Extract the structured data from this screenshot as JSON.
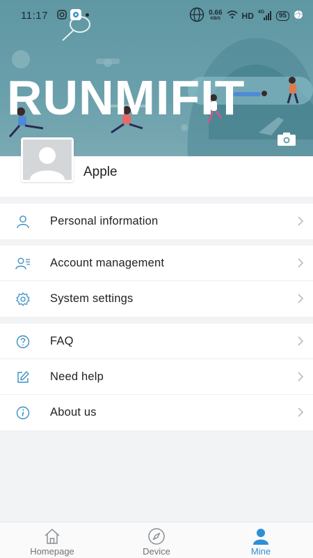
{
  "status_bar": {
    "time": "11:17",
    "network_speed_value": "0.66",
    "network_speed_unit": "KB/S",
    "hd_label": "HD",
    "signal_label": "4G",
    "battery": "95"
  },
  "header": {
    "brand": "RUNMIFIT",
    "camera_icon": "camera-icon"
  },
  "profile": {
    "username": "Apple",
    "avatar_icon": "default-avatar"
  },
  "menu": {
    "group1": [
      {
        "label": "Personal information",
        "icon": "person-icon"
      }
    ],
    "group2": [
      {
        "label": "Account management",
        "icon": "account-list-icon"
      },
      {
        "label": "System settings",
        "icon": "gear-icon"
      }
    ],
    "group3": [
      {
        "label": "FAQ",
        "icon": "question-icon"
      },
      {
        "label": "Need help",
        "icon": "edit-icon"
      },
      {
        "label": "About us",
        "icon": "info-icon"
      }
    ]
  },
  "bottom_nav": {
    "items": [
      {
        "label": "Homepage",
        "icon": "home-icon",
        "active": false
      },
      {
        "label": "Device",
        "icon": "compass-icon",
        "active": false
      },
      {
        "label": "Mine",
        "icon": "user-icon",
        "active": true
      }
    ]
  },
  "colors": {
    "banner": "#6aa0ab",
    "accent": "#2e8fd6",
    "icon": "#3a8fc4",
    "chevron": "#b8bcc0"
  }
}
